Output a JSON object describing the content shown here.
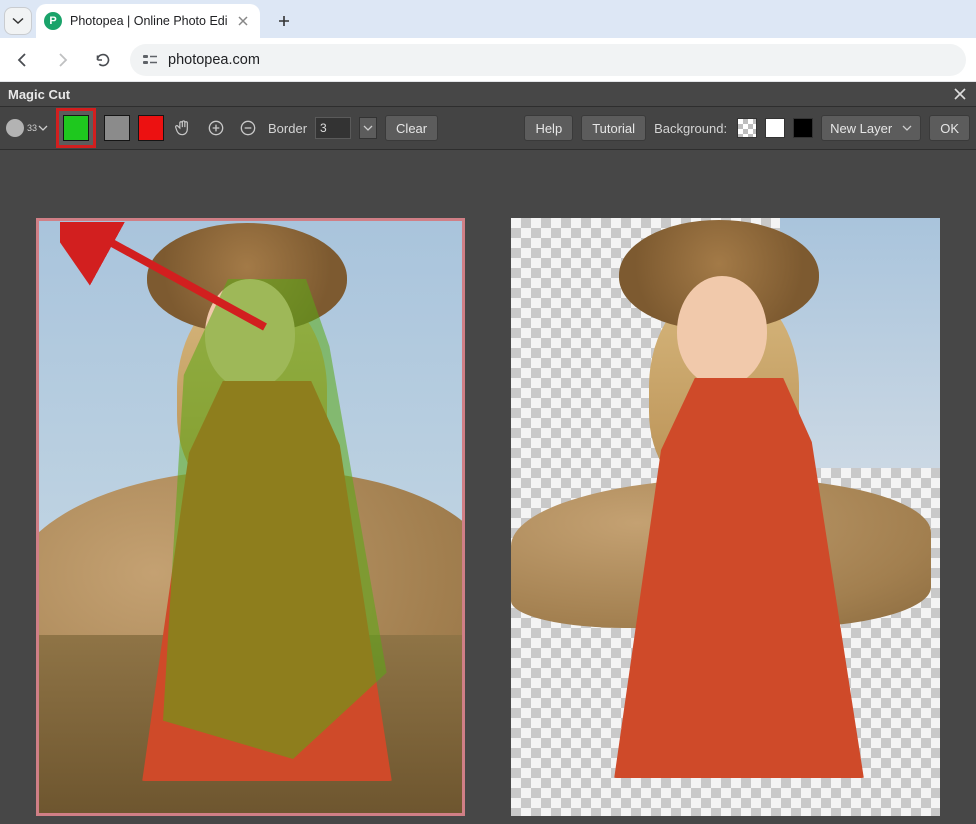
{
  "browser": {
    "tab_title": "Photopea | Online Photo Edi",
    "url": "photopea.com",
    "favicon_letter": "P"
  },
  "dialog": {
    "title": "Magic Cut"
  },
  "toolbar": {
    "brush_size": "33",
    "foreground_swatch_color": "#1ec81e",
    "gray_swatch_color": "#8b8b8b",
    "red_swatch_color": "#ec1111",
    "border_label": "Border",
    "border_value": "3",
    "clear_label": "Clear",
    "help_label": "Help",
    "tutorial_label": "Tutorial",
    "background_label": "Background:",
    "result_select": "New Layer",
    "ok_label": "OK"
  }
}
